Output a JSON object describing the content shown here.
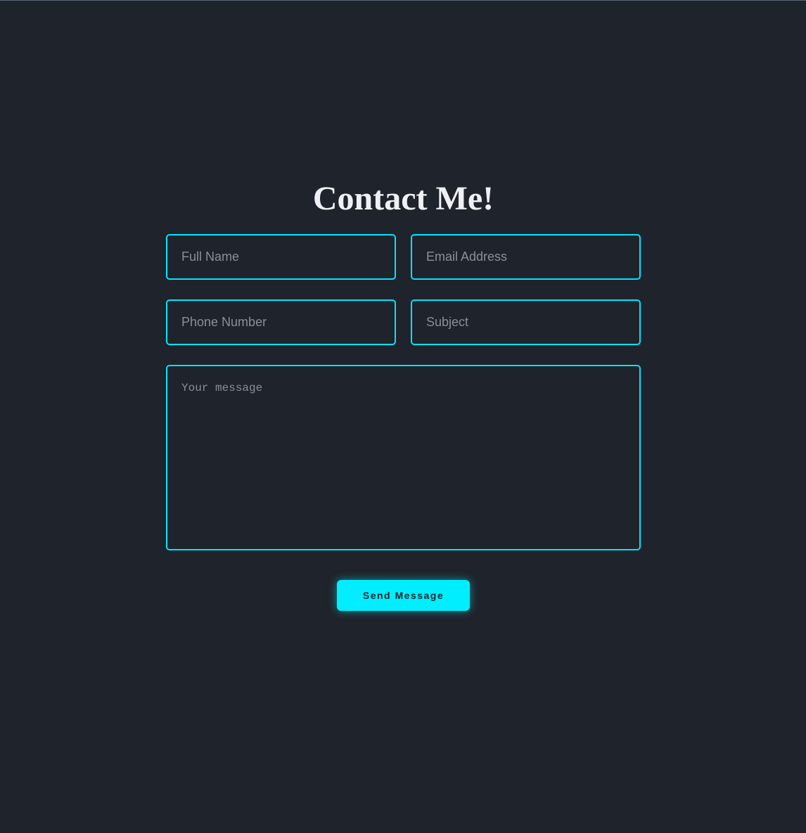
{
  "colors": {
    "background": "#1f232b",
    "accent": "#00e5ff",
    "button": "#00eeff",
    "placeholder": "#8a8f96",
    "title": "#eef0f3"
  },
  "contact_form": {
    "title": "Contact Me!",
    "full_name": {
      "placeholder": "Full Name",
      "value": ""
    },
    "email": {
      "placeholder": "Email Address",
      "value": ""
    },
    "phone": {
      "placeholder": "Phone Number",
      "value": ""
    },
    "subject": {
      "placeholder": "Subject",
      "value": ""
    },
    "message": {
      "placeholder": "Your message",
      "value": ""
    },
    "submit_label": "Send Message"
  }
}
